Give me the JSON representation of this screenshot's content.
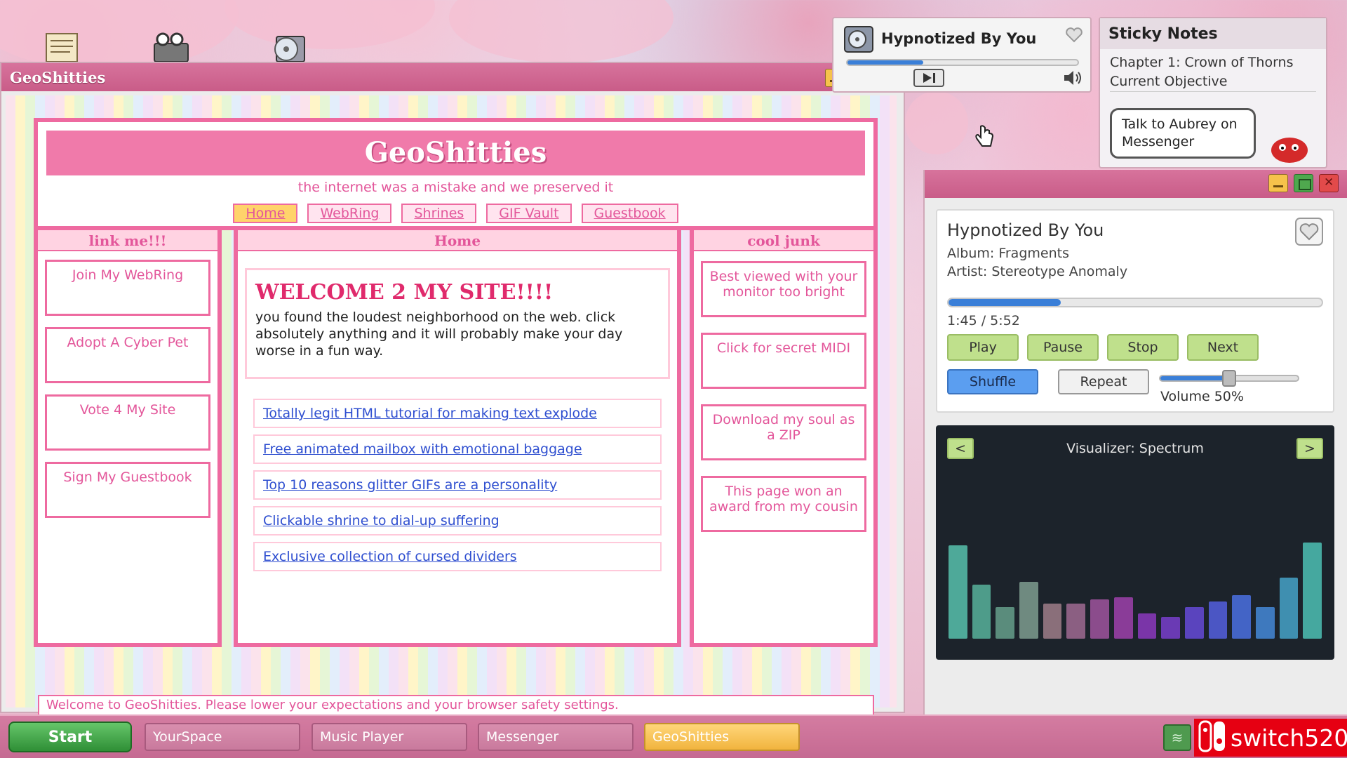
{
  "main_window": {
    "title": "GeoShitties",
    "site": {
      "banner": "GeoShitties",
      "tagline": "the internet was a mistake and we preserved it",
      "nav": [
        "Home",
        "WebRing",
        "Shrines",
        "GIF Vault",
        "Guestbook"
      ],
      "active_nav": "Home",
      "left_column": {
        "heading": "link me!!!",
        "tiles": [
          "Join My WebRing",
          "Adopt A Cyber Pet",
          "Vote 4 My Site",
          "Sign My Guestbook"
        ]
      },
      "center_column": {
        "heading": "Home",
        "welcome_title": "WELCOME 2 MY SITE!!!!",
        "welcome_text": "you found the loudest neighborhood on the web. click absolutely anything and it will probably make your day worse in a fun way.",
        "links": [
          "Totally legit HTML tutorial for making text explode",
          "Free animated mailbox with emotional baggage",
          "Top 10 reasons glitter GIFs are a personality",
          "Clickable shrine to dial-up suffering",
          "Exclusive collection of cursed dividers"
        ]
      },
      "right_column": {
        "heading": "cool junk",
        "tiles": [
          "Best viewed with your monitor too bright",
          "Click for secret MIDI",
          "Download my soul as a ZIP",
          "This page won an award from my cousin"
        ]
      },
      "status": "Welcome to GeoShitties. Please lower your expectations and your browser safety settings."
    }
  },
  "mini_player": {
    "title": "Hypnotized By You",
    "progress": 0.33
  },
  "sticky_notes": {
    "title": "Sticky Notes",
    "chapter": "Chapter 1: Crown of Thorns",
    "objective_label": "Current Objective",
    "objective": "Talk to Aubrey on Messenger"
  },
  "music_player": {
    "song": "Hypnotized By You",
    "album": "Album: Fragments",
    "artist": "Artist: Stereotype Anomaly",
    "time": "1:45 / 5:52",
    "progress": 0.3,
    "buttons": [
      "Play",
      "Pause",
      "Stop",
      "Next"
    ],
    "shuffle_label": "Shuffle",
    "repeat_label": "Repeat",
    "volume_label": "Volume 50%",
    "volume": 0.5,
    "visualizer": {
      "prev": "<",
      "next": ">",
      "title": "Visualizer: Spectrum",
      "levels": [
        0.95,
        0.55,
        0.32,
        0.58,
        0.36,
        0.36,
        0.4,
        0.42,
        0.26,
        0.22,
        0.32,
        0.38,
        0.44,
        0.32,
        0.62,
        0.98
      ],
      "colors": [
        "#4ea999",
        "#4e9c8a",
        "#5a8c7c",
        "#6f8a80",
        "#8a6f7a",
        "#8b5f82",
        "#8b4c8c",
        "#8a3c98",
        "#7a35a8",
        "#6a3ab4",
        "#5a44be",
        "#4b56c4",
        "#4364c6",
        "#3e79be",
        "#3f8fb0",
        "#45a89f"
      ]
    }
  },
  "taskbar": {
    "start": "Start",
    "tasks": [
      "YourSpace",
      "Music Player",
      "Messenger",
      "GeoShitties"
    ],
    "active_task": "GeoShitties",
    "watermark": "switch520"
  },
  "colors": {
    "accent_pink": "#ee6aa0",
    "titlebar_pink": "#d7739c",
    "link_blue": "#2f4fd0",
    "button_green": "#bfe08c",
    "shuffle_blue": "#5b9ef0"
  }
}
